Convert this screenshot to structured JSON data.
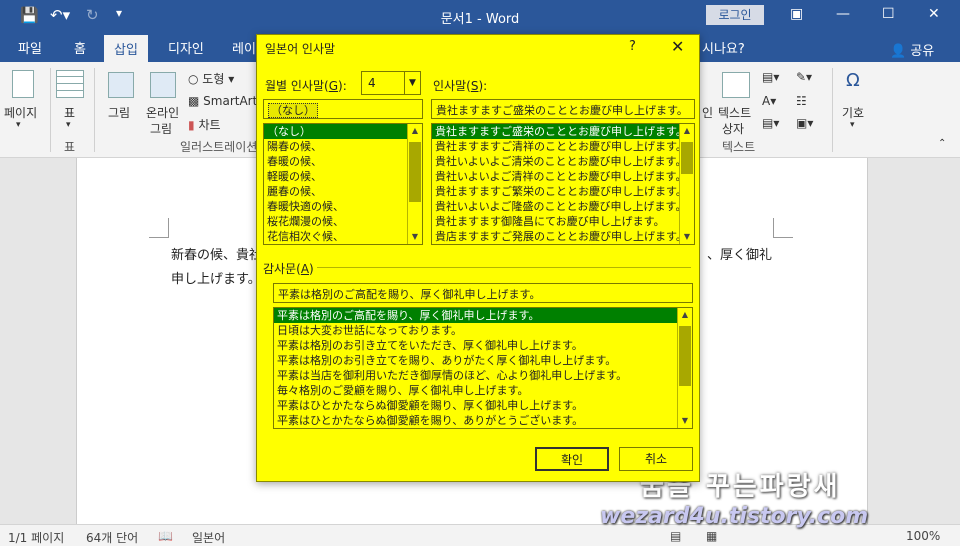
{
  "titlebar": {
    "title": "문서1 - Word",
    "login": "로그인"
  },
  "tabs": {
    "items": [
      "파일",
      "홈",
      "삽입",
      "디자인",
      "레이"
    ],
    "active": "삽입",
    "search_tail": "시나요?",
    "share": "공유"
  },
  "ribbon": {
    "page": "페이지",
    "table": "표",
    "table_group": "표",
    "picture": "그림",
    "online_picture_1": "온라인",
    "online_picture_2": "그림",
    "shapes": "도형",
    "smartart": "SmartArt",
    "chart": "차트",
    "illustrations_group": "일러스트레이션",
    "textbox_1": "텍스트",
    "textbox_2": "상자",
    "text_group": "텍스트",
    "symbol": "기호",
    "in_fragment": "인"
  },
  "document": {
    "line1_start": "新春の候、貴社",
    "line1_end": "、厚く御礼",
    "line2": "申し上げます。"
  },
  "statusbar": {
    "page": "1/1 페이지",
    "words": "64개 단어",
    "language": "일본어",
    "zoom": "100%"
  },
  "watermark": {
    "line1": "꿈을 꾸는파랑새",
    "line2": "wezard4u.tistory.com"
  },
  "dialog": {
    "title": "일본어 인사말",
    "help": "?",
    "month_label": "월별 인사말",
    "month_key": "G",
    "month_value": "4",
    "greeting_label": "인사말",
    "greeting_key": "S",
    "season_selected": "（なし）",
    "season_items": [
      "（なし）",
      "陽春の候、",
      "春暖の候、",
      "軽暖の候、",
      "麗春の候、",
      "春暖快適の候、",
      "桜花爛漫の候、",
      "花信相次ぐ候、"
    ],
    "greeting_selected": "貴社ますますご盛栄のこととお慶び申し上げます。",
    "greeting_items": [
      "貴社ますますご盛栄のこととお慶び申し上げます。",
      "貴社ますますご清祥のこととお慶び申し上げます。",
      "貴社いよいよご清栄のこととお慶び申し上げます。",
      "貴社いよいよご清祥のこととお慶び申し上げます。",
      "貴社ますますご繁栄のこととお慶び申し上げます。",
      "貴社いよいよご隆盛のこととお慶び申し上げます。",
      "貴社ますます御隆昌にてお慶び申し上げます。",
      "貴店ますますご発展のこととお慶び申し上げます。"
    ],
    "thanks_label": "감사문",
    "thanks_key": "A",
    "thanks_selected": "平素は格別のご高配を賜り、厚く御礼申し上げます。",
    "thanks_items": [
      "平素は格別のご高配を賜り、厚く御礼申し上げます。",
      "日頃は大変お世話になっております。",
      "平素は格別のお引き立てをいただき、厚く御礼申し上げます。",
      "平素は格別のお引き立てを賜り、ありがたく厚く御礼申し上げます。",
      "平素は当店を御利用いただき御厚情のほど、心より御礼申し上げます。",
      "毎々格別のご愛顧を賜り、厚く御礼申し上げます。",
      "平素はひとかたならぬ御愛顧を賜り、厚く御礼申し上げます。",
      "平素はひとかたならぬ御愛顧を賜り、ありがとうございます。"
    ],
    "ok": "확인",
    "cancel": "취소",
    "colors": {
      "background": "#ffff00",
      "selection": "#008000"
    }
  }
}
